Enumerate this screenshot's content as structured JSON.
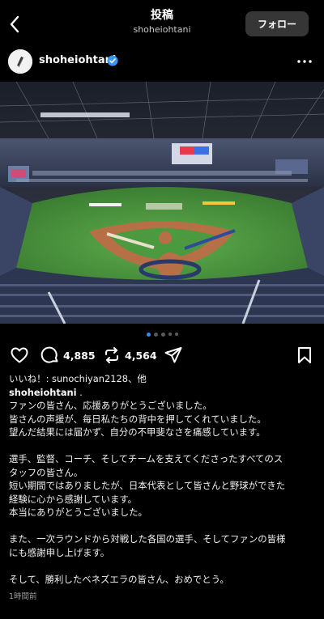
{
  "header": {
    "title": "投稿",
    "subtitle": "shoheiohtani",
    "follow_label": "フォロー"
  },
  "post": {
    "username": "shoheiohtani",
    "verified": true,
    "carousel": {
      "total": 5,
      "active": 0
    }
  },
  "actions": {
    "comments": "4,885",
    "reposts": "4,564"
  },
  "caption": {
    "likes_text": "いいね！: sunochiyan2128、他",
    "author": "shoheiohtani",
    "author_suffix": " .",
    "lines": [
      "ファンの皆さん、応援ありがとうございました。",
      "皆さんの声援が、毎日私たちの背中を押してくれていました。",
      "望んだ結果には届かず、自分の不甲斐なさを痛感しています。",
      "",
      "選手、監督、コーチ、そしてチームを支えてくださったすべてのス",
      "タッフの皆さん。",
      "短い期間ではありましたが、日本代表として皆さんと野球ができた",
      "経験に心から感謝しています。",
      "本当にありがとうございました。",
      "",
      "また、一次ラウンドから対戦した各国の選手、そしてファンの皆様",
      "にも感謝申し上げます。",
      "",
      "そして、勝利したベネズエラの皆さん、おめでとう。"
    ],
    "timestamp": "1時間前"
  },
  "colors": {
    "background": "#000000",
    "follow_button": "#363636",
    "verified_badge": "#3897f0",
    "active_dot": "#2f8ff0"
  },
  "icons": [
    "back-chevron-icon",
    "more-horizontal-icon",
    "heart-icon",
    "comment-icon",
    "repost-icon",
    "share-icon",
    "bookmark-icon",
    "verified-icon"
  ]
}
